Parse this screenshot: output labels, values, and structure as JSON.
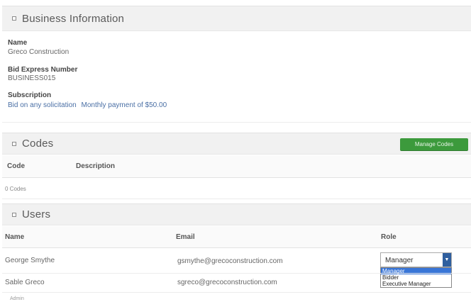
{
  "business": {
    "header": "Business Information",
    "name_label": "Name",
    "name_value": "Greco Construction",
    "bid_label": "Bid Express Number",
    "bid_value": "BUSINESS015",
    "subscription_label": "Subscription",
    "subscription_link1": "Bid on any solicitation",
    "subscription_link2": "Monthly payment of $50.00"
  },
  "codes": {
    "header": "Codes",
    "manage_button": "Manage Codes",
    "col_code": "Code",
    "col_description": "Description",
    "empty_text": "0 Codes"
  },
  "users": {
    "header": "Users",
    "col_name": "Name",
    "col_email": "Email",
    "col_role": "Role",
    "rows": [
      {
        "name": "George Smythe",
        "email": "gsmythe@grecoconstruction.com",
        "role": "Manager"
      },
      {
        "name": "Sable Greco",
        "email": "sgreco@grecoconstruction.com"
      }
    ],
    "role_options": [
      "Manager",
      "Bidder",
      "Executive Manager"
    ],
    "footer_text": "Admin"
  }
}
